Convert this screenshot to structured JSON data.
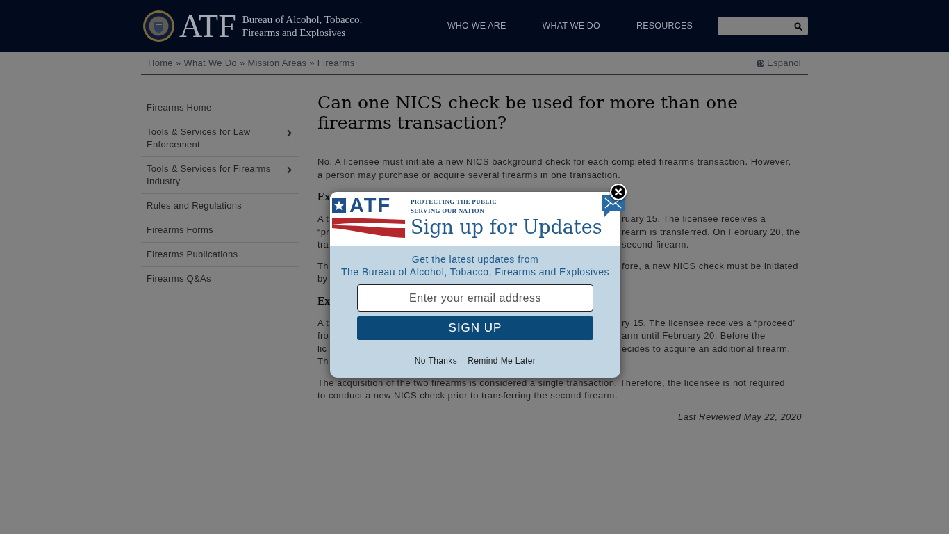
{
  "header": {
    "logo_text": "ATF",
    "agency_name": "Bureau of Alcohol, Tobacco, Firearms and Explosives",
    "nav": [
      "WHO WE ARE",
      "WHAT WE DO",
      "RESOURCES"
    ]
  },
  "breadcrumb": [
    {
      "text": "Home",
      "separator": "»"
    },
    {
      "text": "What We Do",
      "separator": "»"
    },
    {
      "text": "Mission Areas",
      "separator": "»"
    },
    {
      "text": "Firearms"
    }
  ],
  "language_link": "Español",
  "sidebar": {
    "items": [
      {
        "label": "Firearms Home",
        "kind": "link"
      },
      {
        "label": "Tools & Services for Law Enforcement",
        "kind": "submenu"
      },
      {
        "label": "Tools & Services for Firearms Industry",
        "kind": "submenu"
      },
      {
        "label": "Rules and Regulations",
        "kind": "link"
      },
      {
        "label": "Firearms Forms",
        "kind": "link"
      },
      {
        "label": "Firearms Publications",
        "kind": "link"
      },
      {
        "label": "Firearms Q&As",
        "kind": "link"
      }
    ]
  },
  "article": {
    "title": "Can one NICS check be used for more than one firearms transaction?",
    "blocks": [
      {
        "kind": "paragraph",
        "text": "No. A licensee must initiate a new NICS background check for each completed firearms transaction. However, a person may purchase or acquire several firearms in one transaction."
      },
      {
        "kind": "covered_heading",
        "lines": [
          {
            "left": "Ex"
          }
        ]
      },
      {
        "kind": "covered_paragraph",
        "lines": [
          {
            "left": "A t",
            "right": "ruary 15. The licensee receives a"
          },
          {
            "left": "“pr",
            "right": "rearm is transferred. On February 20, the"
          },
          {
            "left": "tra",
            "right": "second firearm."
          }
        ]
      },
      {
        "kind": "covered_paragraph",
        "lines": [
          {
            "left": "Th",
            "right": "fore, a new NICS check must be initiated"
          },
          {
            "left": "by"
          }
        ]
      },
      {
        "kind": "covered_heading",
        "lines": [
          {
            "left": "Ex"
          }
        ]
      },
      {
        "kind": "covered_paragraph",
        "lines": [
          {
            "left": "A t",
            "right": "ry 15. The licensee receives a “proceed”"
          },
          {
            "left": "fro",
            "right": "arm until February 20. Before the"
          },
          {
            "left": "lic",
            "right": "ecides to acquire an additional firearm."
          },
          {
            "left": "Th"
          }
        ]
      },
      {
        "kind": "paragraph",
        "text": "The acquisition of the two firearms is considered a single transaction. Therefore, the licensee is not required to conduct a new NICS check prior to transferring the second firearm."
      }
    ],
    "last_reviewed": "Last Reviewed May 22, 2020"
  },
  "popup": {
    "logo_text": "ATF",
    "tagline": [
      "PROTECTING THE PUBLIC",
      "SERVING OUR NATION"
    ],
    "title": "Sign up for Updates",
    "intro": [
      "Get the latest updates from",
      "The Bureau of Alcohol, Tobacco, Firearms and Explosives"
    ],
    "email_field": {
      "placeholder": "Enter your email address"
    },
    "submit_label": "SIGN UP",
    "links": [
      "No Thanks",
      "Remind Me Later"
    ]
  }
}
